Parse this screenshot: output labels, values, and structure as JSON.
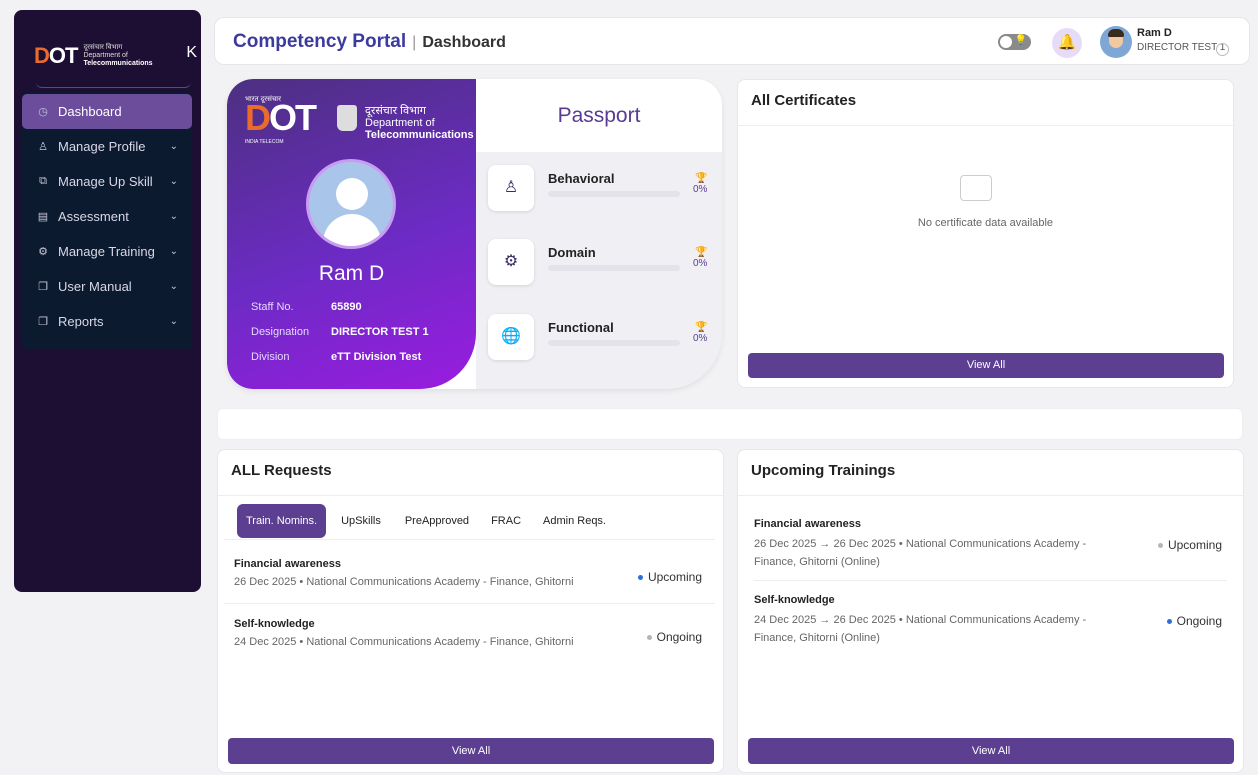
{
  "sidebar": {
    "logo_text": "DOT",
    "logo_dept_hi": "दूरसंचार विभाग",
    "logo_dept_en": "Department of",
    "logo_dept_en2": "Telecommunications",
    "items": [
      {
        "label": "Dashboard",
        "icon": "dashboard-icon",
        "active": true
      },
      {
        "label": "Manage Profile",
        "icon": "user-icon"
      },
      {
        "label": "Manage Up Skill",
        "icon": "skill-icon"
      },
      {
        "label": "Assessment",
        "icon": "assessment-icon"
      },
      {
        "label": "Manage Training",
        "icon": "gear-icon"
      },
      {
        "label": "User Manual",
        "icon": "document-icon"
      },
      {
        "label": "Reports",
        "icon": "document-icon"
      }
    ]
  },
  "header": {
    "app_title": "Competency Portal",
    "separator": "|",
    "page": "Dashboard",
    "user_name": "Ram D",
    "user_role": "DIRECTOR TEST 1"
  },
  "passport": {
    "logo_hi": "भारत दूरसंचार",
    "logo_dept_hi": "दूरसंचार विभाग",
    "logo_dept_en": "Department of",
    "logo_dept_en2": "Telecommunications",
    "logo_sub": "INDIA TELECOM",
    "name": "Ram D",
    "title": "Passport",
    "fields": [
      {
        "key": "Staff No.",
        "value": "65890"
      },
      {
        "key": "Designation",
        "value": "DIRECTOR TEST 1"
      },
      {
        "key": "Division",
        "value": "eTT Division Test"
      }
    ],
    "competencies": [
      {
        "label": "Behavioral",
        "percent": "0%",
        "progress": 0,
        "icon": "user-icon"
      },
      {
        "label": "Domain",
        "percent": "0%",
        "progress": 0,
        "icon": "gear-icon"
      },
      {
        "label": "Functional",
        "percent": "0%",
        "progress": 0,
        "icon": "globe-icon"
      }
    ]
  },
  "certificates": {
    "title": "All Certificates",
    "empty_text": "No certificate data available",
    "view_all": "View All"
  },
  "requests": {
    "title": "ALL Requests",
    "tabs": [
      "Train. Nomins.",
      "UpSkills",
      "PreApproved",
      "FRAC",
      "Admin Reqs."
    ],
    "items": [
      {
        "title": "Financial awareness",
        "detail": "26 Dec 2025 • National Communications Academy - Finance, Ghitorni",
        "status": "Upcoming",
        "status_color": "#2b6fd6"
      },
      {
        "title": "Self-knowledge",
        "detail": "24 Dec 2025 • National Communications Academy - Finance, Ghitorni",
        "status": "Ongoing",
        "status_color": "#b5b5b5"
      }
    ],
    "view_all": "View All"
  },
  "trainings": {
    "title": "Upcoming Trainings",
    "items": [
      {
        "title": "Financial awareness",
        "detail": "26 Dec 2025 → 26 Dec 2025 • National Communications Academy - Finance, Ghitorni (Online)",
        "status": "Upcoming",
        "status_color": "#b5b5b5"
      },
      {
        "title": "Self-knowledge",
        "detail": "24 Dec 2025 → 26 Dec 2025 • National Communications Academy - Finance, Ghitorni (Online)",
        "status": "Ongoing",
        "status_color": "#2b6fd6"
      }
    ],
    "view_all": "View All"
  }
}
